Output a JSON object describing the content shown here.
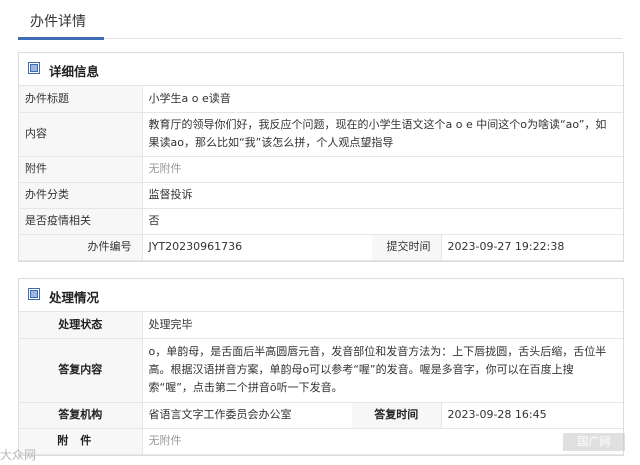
{
  "page": {
    "title": "办件详情"
  },
  "detail": {
    "title": "详细信息",
    "rows": {
      "subject": {
        "label": "办件标题",
        "value": "小学生a o e读音"
      },
      "content": {
        "label": "内容",
        "value": "教育厅的领导你们好，我反应个问题，现在的小学生语文这个a o e 中间这个o为啥读“ao”，如果读ao，那么比如“我”该怎么拼，个人观点望指导"
      },
      "attachment": {
        "label": "附件",
        "value": "无附件"
      },
      "category": {
        "label": "办件分类",
        "value": "监督投诉"
      },
      "epidemic": {
        "label": "是否疫情相关",
        "value": "否"
      },
      "number": {
        "label": "办件编号",
        "value": "JYT20230961736"
      },
      "submit_time": {
        "label": "提交时间",
        "value": "2023-09-27 19:22:38"
      }
    }
  },
  "handling": {
    "title": "处理情况",
    "rows": {
      "status": {
        "label": "处理状态",
        "value": "处理完毕"
      },
      "reply": {
        "label": "答复内容",
        "value": "o，单韵母，是舌面后半高圆唇元音，发音部位和发音方法为：上下唇拢圆，舌头后缩，舌位半高。根据汉语拼音方案，单韵母o可以参考“喔”的发音。喔是多音字，你可以在百度上搜索“喔”，点击第二个拼音ō听一下发音。"
      },
      "org": {
        "label": "答复机构",
        "value": "省语言文字工作委员会办公室"
      },
      "reply_time": {
        "label": "答复时间",
        "value": "2023-09-28 16:45"
      },
      "attachment": {
        "label": "附件",
        "value": "无附件"
      }
    }
  },
  "watermarks": {
    "left": "大众网",
    "right": "国广网"
  },
  "colors": {
    "accent": "#3d6cb4",
    "label_bg": "#f7f7f7",
    "border": "#e6e6e6"
  },
  "icons": {
    "panel": "list-panel-icon"
  }
}
